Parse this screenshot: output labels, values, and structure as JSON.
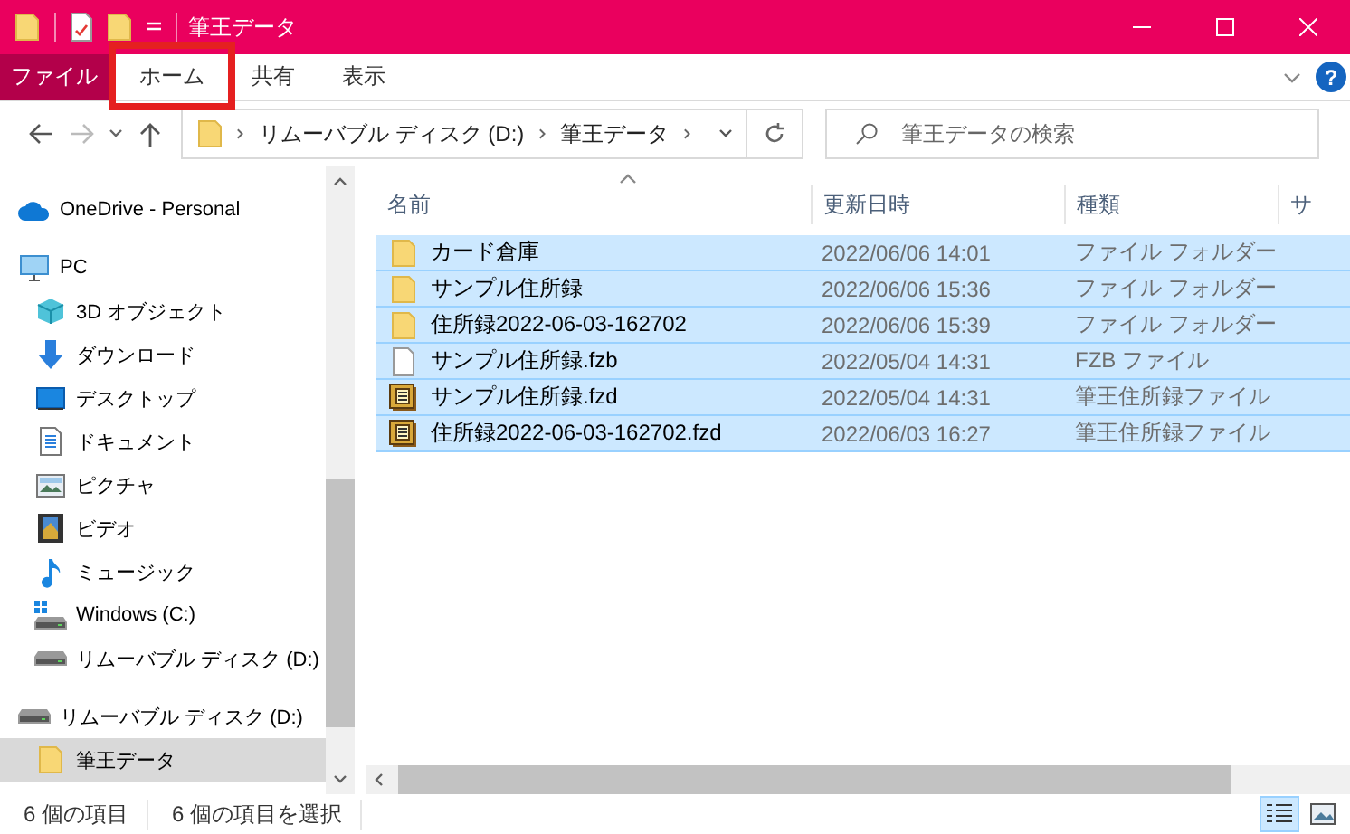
{
  "window": {
    "title": "筆王データ"
  },
  "ribbon": {
    "tabs": [
      {
        "label": "ファイル",
        "kind": "file",
        "highlighted": false
      },
      {
        "label": "ホーム",
        "kind": "tab",
        "highlighted": true
      },
      {
        "label": "共有",
        "kind": "tab",
        "highlighted": false
      },
      {
        "label": "表示",
        "kind": "tab",
        "highlighted": false
      }
    ],
    "help": "?"
  },
  "address": {
    "path": [
      "リムーバブル ディスク (D:)",
      "筆王データ"
    ]
  },
  "search": {
    "placeholder": "筆王データの検索"
  },
  "navigation": {
    "items": [
      {
        "label": "OneDrive - Personal",
        "kind": "cloud",
        "selected": false
      },
      {
        "label": "PC",
        "kind": "pc",
        "selected": false,
        "children": [
          {
            "label": "3D オブジェクト",
            "kind": "cube",
            "selected": false
          },
          {
            "label": "ダウンロード",
            "kind": "download",
            "selected": false
          },
          {
            "label": "デスクトップ",
            "kind": "desktop",
            "selected": false
          },
          {
            "label": "ドキュメント",
            "kind": "document",
            "selected": false
          },
          {
            "label": "ピクチャ",
            "kind": "pictures",
            "selected": false
          },
          {
            "label": "ビデオ",
            "kind": "video",
            "selected": false
          },
          {
            "label": "ミュージック",
            "kind": "music",
            "selected": false
          },
          {
            "label": "Windows (C:)",
            "kind": "system-drive",
            "selected": false
          },
          {
            "label": "リムーバブル ディスク (D:)",
            "kind": "drive",
            "selected": false
          }
        ]
      },
      {
        "label": "リムーバブル ディスク (D:)",
        "kind": "drive",
        "selected": false,
        "children": [
          {
            "label": "筆王データ",
            "kind": "folder",
            "selected": true
          }
        ]
      }
    ]
  },
  "file_list": {
    "columns": [
      "名前",
      "更新日時",
      "種類",
      "サ"
    ],
    "rows": [
      {
        "name": "カード倉庫",
        "modified": "2022/06/06 14:01",
        "type": "ファイル フォルダー",
        "kind": "folder",
        "selected": true
      },
      {
        "name": "サンプル住所録",
        "modified": "2022/06/06 15:36",
        "type": "ファイル フォルダー",
        "kind": "folder",
        "selected": true
      },
      {
        "name": "住所録2022-06-03-162702",
        "modified": "2022/06/06 15:39",
        "type": "ファイル フォルダー",
        "kind": "folder",
        "selected": true
      },
      {
        "name": "サンプル住所録.fzb",
        "modified": "2022/05/04 14:31",
        "type": "FZB ファイル",
        "kind": "file",
        "selected": true
      },
      {
        "name": "サンプル住所録.fzd",
        "modified": "2022/05/04 14:31",
        "type": "筆王住所録ファイル",
        "kind": "address-book",
        "selected": true
      },
      {
        "name": "住所録2022-06-03-162702.fzd",
        "modified": "2022/06/03 16:27",
        "type": "筆王住所録ファイル",
        "kind": "address-book",
        "selected": true
      }
    ]
  },
  "status_bar": {
    "item_count": "6 個の項目",
    "selection": "6 個の項目を選択"
  },
  "views": [
    {
      "kind": "details",
      "selected": true
    },
    {
      "kind": "large-icons",
      "selected": false
    }
  ]
}
